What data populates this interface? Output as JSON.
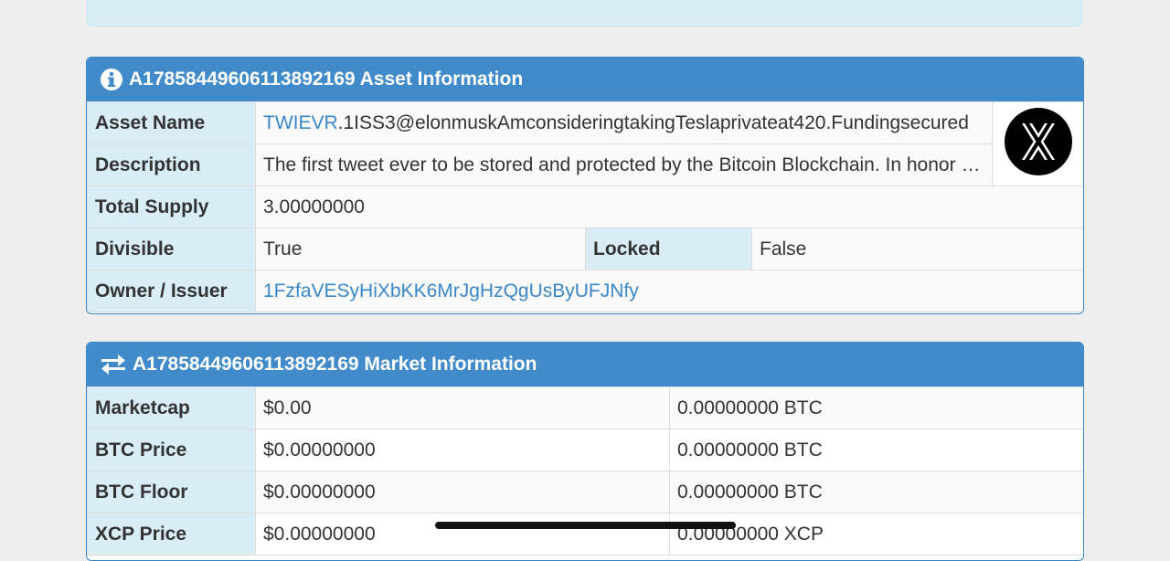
{
  "asset_panel": {
    "title": "A17858449606113892169 Asset Information",
    "rows": {
      "asset_name_label": "Asset Name",
      "asset_name_link": "TWIEVR",
      "asset_name_rest": ".1ISS3@elonmuskAmconsideringtakingTeslaprivateat420.Fundingsecured",
      "description_label": "Description",
      "description_value": "The first tweet ever to be stored and protected by the Bitcoin Blockchain. In honor of the original tweet",
      "total_supply_label": "Total Supply",
      "total_supply_value": "3.00000000",
      "divisible_label": "Divisible",
      "divisible_value": "True",
      "locked_label": "Locked",
      "locked_value": "False",
      "owner_label": "Owner / Issuer",
      "owner_value": "1FzfaVESyHiXbKK6MrJgHzQgUsByUFJNfy"
    },
    "image_icon": "x-logo-icon"
  },
  "market_panel": {
    "title": "A17858449606113892169 Market Information",
    "rows": [
      {
        "label": "Marketcap",
        "usd": "$0.00",
        "alt": "0.00000000 BTC"
      },
      {
        "label": "BTC Price",
        "usd": "$0.00000000",
        "alt": "0.00000000 BTC"
      },
      {
        "label": "BTC Floor",
        "usd": "$0.00000000",
        "alt": "0.00000000 BTC"
      },
      {
        "label": "XCP Price",
        "usd": "$0.00000000",
        "alt": "0.00000000 XCP"
      }
    ]
  },
  "colors": {
    "heading": "#428bca",
    "label_bg": "#d9edf7",
    "link": "#3a87c8"
  }
}
